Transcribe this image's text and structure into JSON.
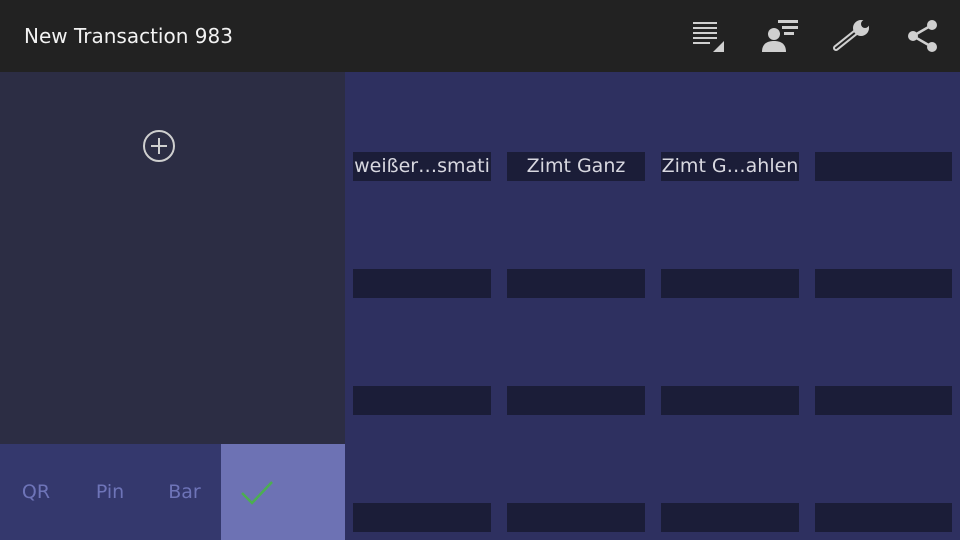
{
  "header": {
    "title": "New Transaction 983",
    "actions": [
      {
        "icon": "list-details-icon"
      },
      {
        "icon": "contact-list-icon"
      },
      {
        "icon": "wrench-icon"
      },
      {
        "icon": "share-icon"
      }
    ]
  },
  "left_panel": {
    "add_icon": "add-circle-icon"
  },
  "bottom_tabs": {
    "qr": "QR",
    "pin": "Pin",
    "bar": "Bar",
    "confirm_icon": "checkmark-icon"
  },
  "products": {
    "row0": [
      "weißer…smati",
      "Zimt Ganz",
      "Zimt G…ahlen",
      ""
    ],
    "row1": [
      "",
      "",
      "",
      ""
    ],
    "row2": [
      "",
      "",
      "",
      ""
    ],
    "row3": [
      "",
      "",
      "",
      ""
    ]
  },
  "colors": {
    "topbar": "#222222",
    "left_panel": "#2c2d44",
    "grid_background": "#2e3060",
    "cell": "#1b1d38",
    "tab_bar": "#34386d",
    "confirm": "#6d72b4",
    "check": "#4caf50"
  }
}
